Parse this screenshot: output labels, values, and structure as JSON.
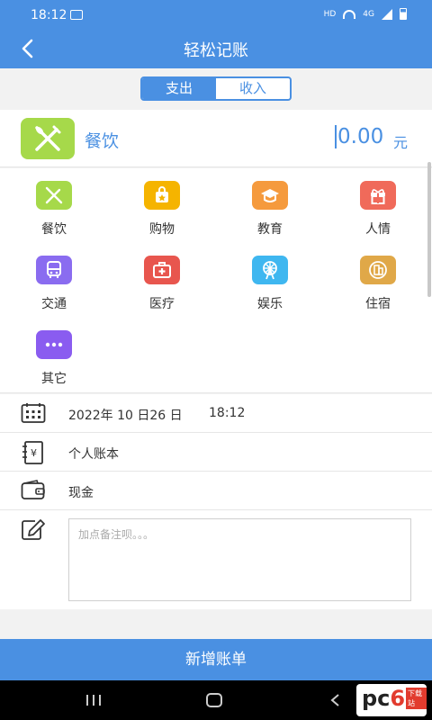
{
  "status_bar": {
    "time": "18:12",
    "network": "HD",
    "net_type": "4G"
  },
  "header": {
    "title": "轻松记账"
  },
  "tabs": [
    {
      "label": "支出",
      "active": true
    },
    {
      "label": "收入",
      "active": false
    }
  ],
  "entry": {
    "category": "餐饮",
    "amount": "0.00",
    "unit": "元",
    "category_color": "#a6d94a"
  },
  "categories": [
    {
      "label": "餐饮",
      "icon": "fork-knife-icon",
      "color": "#a6d94a"
    },
    {
      "label": "购物",
      "icon": "shopping-bag-icon",
      "color": "#f5b400"
    },
    {
      "label": "教育",
      "icon": "graduation-cap-icon",
      "color": "#f59a3d"
    },
    {
      "label": "人情",
      "icon": "gift-icon",
      "color": "#f06a5a"
    },
    {
      "label": "交通",
      "icon": "bus-icon",
      "color": "#8a6cf0"
    },
    {
      "label": "医疗",
      "icon": "medical-kit-icon",
      "color": "#e8564e"
    },
    {
      "label": "娱乐",
      "icon": "ferris-wheel-icon",
      "color": "#3fb7f0"
    },
    {
      "label": "住宿",
      "icon": "building-icon",
      "color": "#e0a848"
    },
    {
      "label": "其它",
      "icon": "more-dots-icon",
      "color": "#8a5cf0"
    }
  ],
  "details": {
    "date": "2022年 10 日26 日",
    "time": "18:12",
    "account_book": "个人账本",
    "payment": "现金",
    "note_placeholder": "加点备注呗。。。"
  },
  "submit_label": "新增账单",
  "watermark": {
    "brand_a": "pc",
    "brand_b": "6",
    "tag": "下载站"
  },
  "accent_color": "#4a90e2"
}
